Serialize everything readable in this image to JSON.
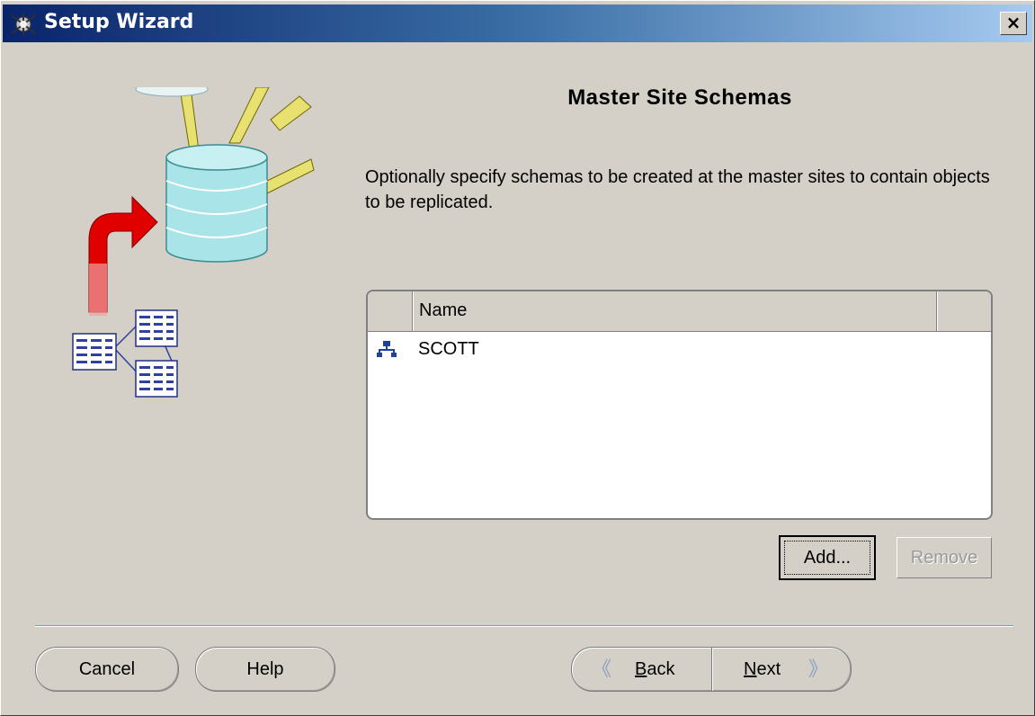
{
  "window": {
    "title": "Setup Wizard",
    "close_label": "×"
  },
  "page": {
    "title": "Master Site Schemas",
    "description": "Optionally specify schemas to be created at the master sites to contain objects to be replicated."
  },
  "schema_table": {
    "columns": [
      "",
      "Name",
      ""
    ],
    "rows": [
      {
        "icon": "schema-icon",
        "name": "SCOTT"
      }
    ]
  },
  "buttons": {
    "add": "Add...",
    "remove": "Remove",
    "cancel": "Cancel",
    "help": "Help",
    "back_mnemonic": "B",
    "back_rest": "ack",
    "next_mnemonic": "N",
    "next_rest": "ext",
    "back_chevron": "《",
    "next_chevron": "》"
  },
  "colors": {
    "title_bar_start": "#0a246a",
    "title_bar_end": "#a6caf0",
    "dialog_bg": "#d4d0c8",
    "arrow_red": "#e00000",
    "database_cyan": "#a8e4e8"
  }
}
